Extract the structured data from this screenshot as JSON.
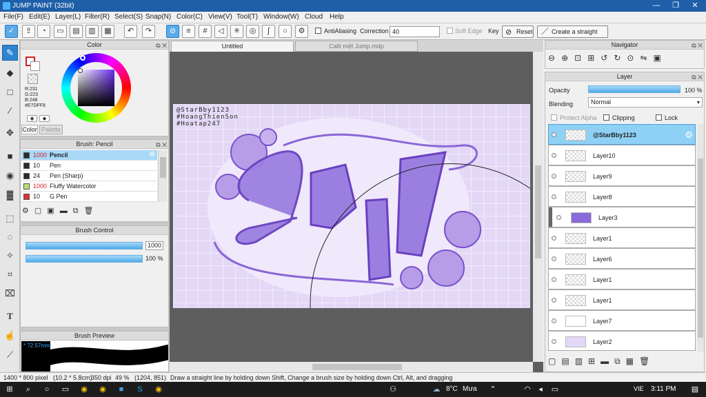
{
  "app": {
    "title": "JUMP PAINT (32bit)"
  },
  "window_controls": {
    "minimize": "—",
    "restore": "❐",
    "close": "✕"
  },
  "menu": [
    "File(F)",
    "Edit(E)",
    "Layer(L)",
    "Filter(R)",
    "Select(S)",
    "Snap(N)",
    "Color(C)",
    "View(V)",
    "Tool(T)",
    "Window(W)",
    "Cloud",
    "Help"
  ],
  "toolbar": {
    "antialiasing_label": "AntiAliasing",
    "correction_label": "Correction",
    "correction_value": "40",
    "soft_edge_label": "Soft Edge",
    "key_label": "Key",
    "reset_label": "Reset",
    "straight_line_label": "Create a straight line"
  },
  "color_panel": {
    "title": "Color",
    "rgb_r": "R:231",
    "rgb_g": "G:223",
    "rgb_b": "B:248",
    "hex": "#E7DFF8",
    "tab_color": "Color",
    "tab_palette": "Palette",
    "primary_color": "#e7dff8"
  },
  "brush_panel": {
    "title": "Brush: Pencil",
    "brushes": [
      {
        "size": "1000",
        "name": "Pencil",
        "color": "#2a2a2a"
      },
      {
        "size": "10",
        "name": "Pen",
        "color": "#2a2a2a"
      },
      {
        "size": "24",
        "name": "Pen (Sharp)",
        "color": "#2a2a2a"
      },
      {
        "size": "1000",
        "name": "Fluffy Watercolor",
        "color": "#b8e07a"
      },
      {
        "size": "10",
        "name": "G Pen",
        "color": "#e03030"
      }
    ]
  },
  "brush_control": {
    "title": "Brush Control",
    "size_value": "1000",
    "opacity_value": "100 %",
    "size_fraction": 1.0,
    "opacity_fraction": 1.0
  },
  "brush_preview": {
    "title": "Brush Preview",
    "size_label": "* 72.57mm"
  },
  "canvas": {
    "tabs": [
      "Untitled",
      "Calli mệt Jump.mdp"
    ],
    "artwork_lines": [
      "@StarBby1123",
      "#HoangThienSon",
      "#Hoatap247"
    ]
  },
  "navigator": {
    "title": "Navigator"
  },
  "layer_panel": {
    "title": "Layer",
    "opacity_label": "Opacity",
    "opacity_value": "100 %",
    "opacity_fraction": 1.0,
    "blending_label": "Blending",
    "blending_value": "Normal",
    "protect_alpha": "Protect Alpha",
    "clipping": "Clipping",
    "lock": "Lock",
    "layers": [
      "@StarBby1123",
      "Layer10",
      "Layer9",
      "Layer8",
      "Layer3",
      "Layer1",
      "Layer6",
      "Layer1",
      "Layer1",
      "Layer7",
      "Layer2"
    ]
  },
  "status": {
    "dimensions": "1400 * 800 pixel",
    "size_cm": "(10.2 * 5.8cm)",
    "dpi": "350 dpi",
    "zoom": "49 %",
    "cursor": "(1204, 851)",
    "hint": "Draw a straight line by holding down Shift, Change a brush size by holding down Ctrl, Alt, and dragging"
  },
  "taskbar": {
    "weather": "8°C",
    "weather_text": "Mưa",
    "lang": "VIE",
    "time": "3:11 PM"
  }
}
